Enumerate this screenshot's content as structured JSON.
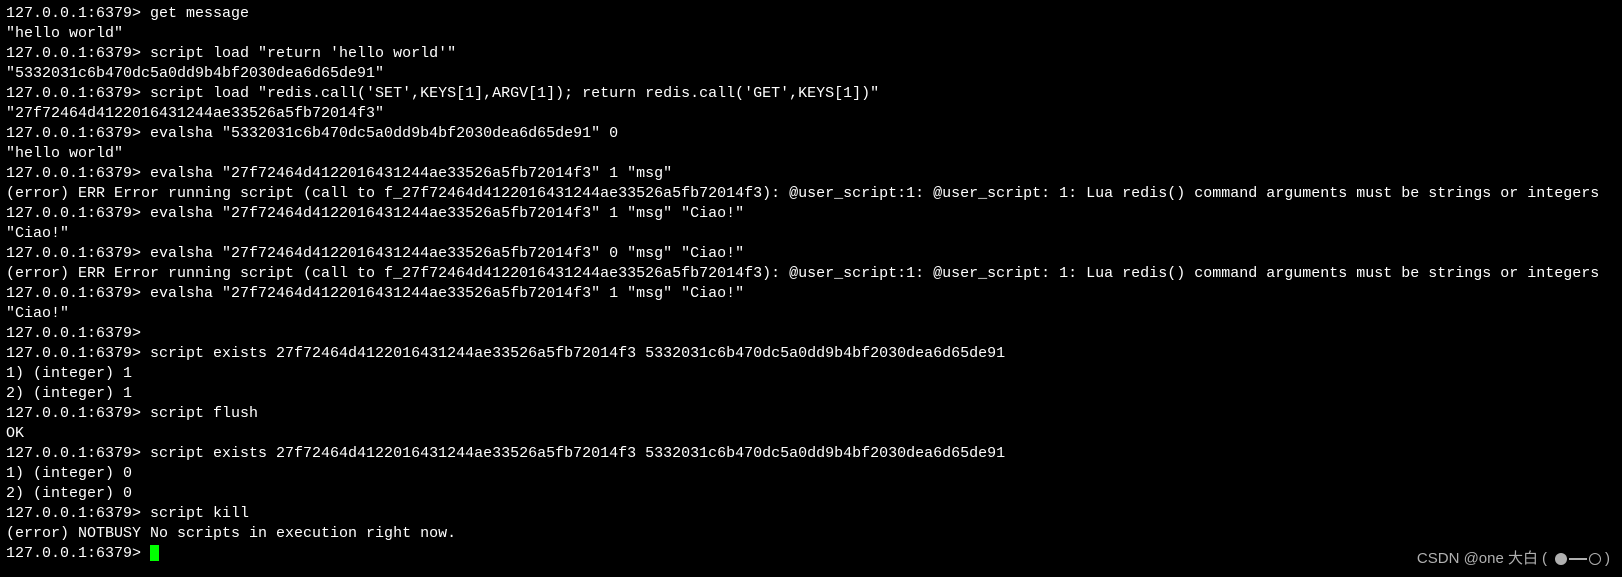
{
  "prompt": "127.0.0.1:6379>",
  "lines": [
    {
      "type": "cmd",
      "text": "get message"
    },
    {
      "type": "out",
      "text": "\"hello world\""
    },
    {
      "type": "cmd",
      "text": "script load \"return 'hello world'\""
    },
    {
      "type": "out",
      "text": "\"5332031c6b470dc5a0dd9b4bf2030dea6d65de91\""
    },
    {
      "type": "cmd",
      "text": "script load \"redis.call('SET',KEYS[1],ARGV[1]); return redis.call('GET',KEYS[1])\""
    },
    {
      "type": "out",
      "text": "\"27f72464d4122016431244ae33526a5fb72014f3\""
    },
    {
      "type": "cmd",
      "text": "evalsha \"5332031c6b470dc5a0dd9b4bf2030dea6d65de91\" 0"
    },
    {
      "type": "out",
      "text": "\"hello world\""
    },
    {
      "type": "cmd",
      "text": "evalsha \"27f72464d4122016431244ae33526a5fb72014f3\" 1 \"msg\""
    },
    {
      "type": "out",
      "text": "(error) ERR Error running script (call to f_27f72464d4122016431244ae33526a5fb72014f3): @user_script:1: @user_script: 1: Lua redis() command arguments must be strings or integers"
    },
    {
      "type": "cmd",
      "text": "evalsha \"27f72464d4122016431244ae33526a5fb72014f3\" 1 \"msg\" \"Ciao!\""
    },
    {
      "type": "out",
      "text": "\"Ciao!\""
    },
    {
      "type": "cmd",
      "text": "evalsha \"27f72464d4122016431244ae33526a5fb72014f3\" 0 \"msg\" \"Ciao!\""
    },
    {
      "type": "out",
      "text": "(error) ERR Error running script (call to f_27f72464d4122016431244ae33526a5fb72014f3): @user_script:1: @user_script: 1: Lua redis() command arguments must be strings or integers"
    },
    {
      "type": "cmd",
      "text": "evalsha \"27f72464d4122016431244ae33526a5fb72014f3\" 1 \"msg\" \"Ciao!\""
    },
    {
      "type": "out",
      "text": "\"Ciao!\""
    },
    {
      "type": "cmd",
      "text": ""
    },
    {
      "type": "cmd",
      "text": "script exists 27f72464d4122016431244ae33526a5fb72014f3 5332031c6b470dc5a0dd9b4bf2030dea6d65de91"
    },
    {
      "type": "out",
      "text": "1) (integer) 1"
    },
    {
      "type": "out",
      "text": "2) (integer) 1"
    },
    {
      "type": "cmd",
      "text": "script flush"
    },
    {
      "type": "out",
      "text": "OK"
    },
    {
      "type": "cmd",
      "text": "script exists 27f72464d4122016431244ae33526a5fb72014f3 5332031c6b470dc5a0dd9b4bf2030dea6d65de91"
    },
    {
      "type": "out",
      "text": "1) (integer) 0"
    },
    {
      "type": "out",
      "text": "2) (integer) 0"
    },
    {
      "type": "cmd",
      "text": "script kill"
    },
    {
      "type": "out",
      "text": "(error) NOTBUSY No scripts in execution right now."
    },
    {
      "type": "cmd-cursor",
      "text": ""
    }
  ],
  "watermark": "CSDN @one 大白"
}
